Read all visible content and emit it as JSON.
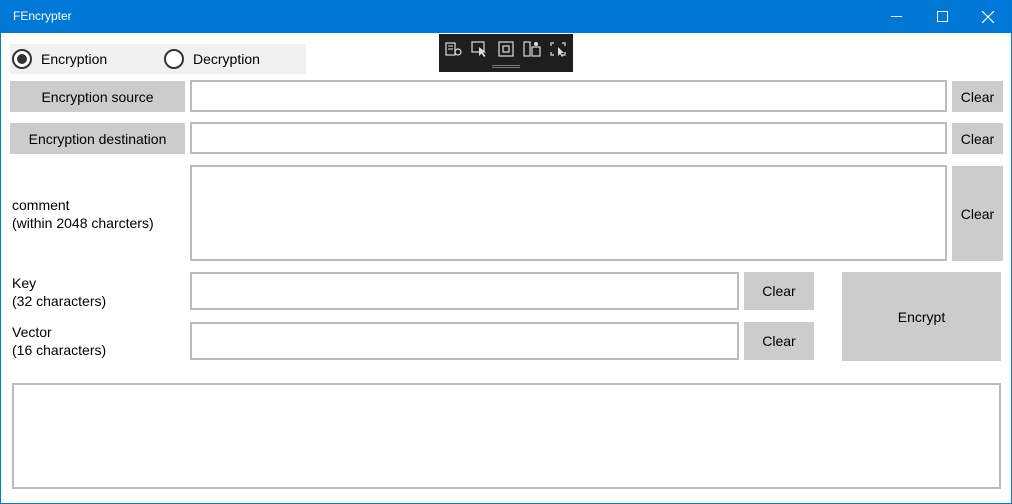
{
  "window": {
    "title": "FEncrypter"
  },
  "mode": {
    "encryption_label": "Encryption",
    "decryption_label": "Decryption",
    "selected": "Encryption"
  },
  "source": {
    "button_label": "Encryption source",
    "value": "",
    "clear_label": "Clear"
  },
  "destination": {
    "button_label": "Encryption destination",
    "value": "",
    "clear_label": "Clear"
  },
  "comment": {
    "label_line1": "comment",
    "label_line2": "(within 2048 charcters)",
    "value": "",
    "clear_label": "Clear"
  },
  "key": {
    "label_line1": "Key",
    "label_line2": "(32 characters)",
    "value": "",
    "clear_label": "Clear"
  },
  "vector": {
    "label_line1": "Vector",
    "label_line2": "(16 characters)",
    "value": "",
    "clear_label": "Clear"
  },
  "action": {
    "encrypt_label": "Encrypt"
  },
  "output": {
    "value": ""
  },
  "debug_toolbar": {
    "icons": [
      "live-visual-tree-icon",
      "select-element-icon",
      "display-layout-adorners-icon",
      "track-focus-icon",
      "hot-reload-icon"
    ]
  }
}
